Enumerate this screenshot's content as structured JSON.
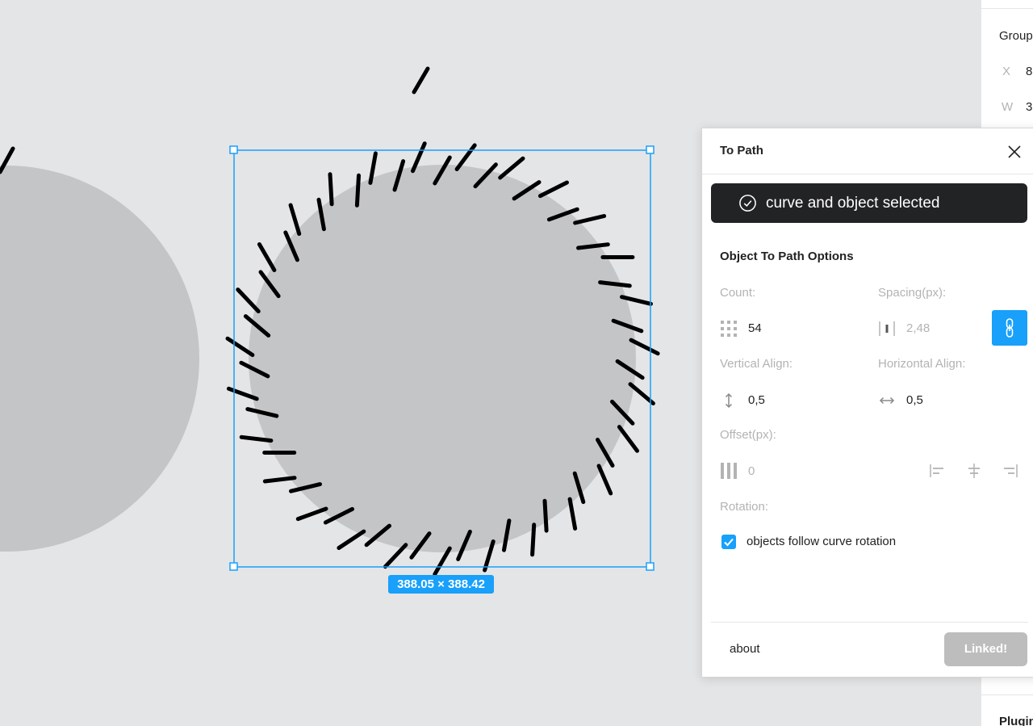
{
  "canvas": {
    "selection_size": "388.05 × 388.42",
    "colors": {
      "background": "#e4e5e7",
      "shape_fill": "#c4c5c7",
      "tick_stroke": "#000000",
      "selection": "#18a0fb"
    }
  },
  "properties_panel": {
    "section": "Group",
    "x_label": "X",
    "x_value": "8",
    "w_label": "W",
    "w_value": "3",
    "bottom_section": "Plugin"
  },
  "plugin": {
    "title": "To Path",
    "close_icon": "close-icon",
    "toast": {
      "icon": "check-circle-icon",
      "text": "curve and object selected"
    },
    "section_title": "Object To Path Options",
    "count": {
      "label": "Count:",
      "value": "54",
      "icon": "grid-dots-icon"
    },
    "spacing": {
      "label": "Spacing(px):",
      "value": "2,48",
      "icon": "spacing-icon"
    },
    "link_icon": "link-icon",
    "vertical_align": {
      "label": "Vertical Align:",
      "value": "0,5",
      "icon": "vertical-arrow-icon"
    },
    "horizontal_align": {
      "label": "Horizontal Align:",
      "value": "0,5",
      "icon": "horizontal-arrow-icon"
    },
    "offset": {
      "label": "Offset(px):",
      "value": "0",
      "icon": "offset-bars-icon"
    },
    "align_icons": [
      "align-left-icon",
      "align-center-icon",
      "align-right-icon"
    ],
    "rotation": {
      "label": "Rotation:",
      "checkbox_label": "objects follow curve rotation",
      "checked": true
    },
    "about_label": "about",
    "linked_label": "Linked!",
    "accent": "#18a0fb"
  }
}
